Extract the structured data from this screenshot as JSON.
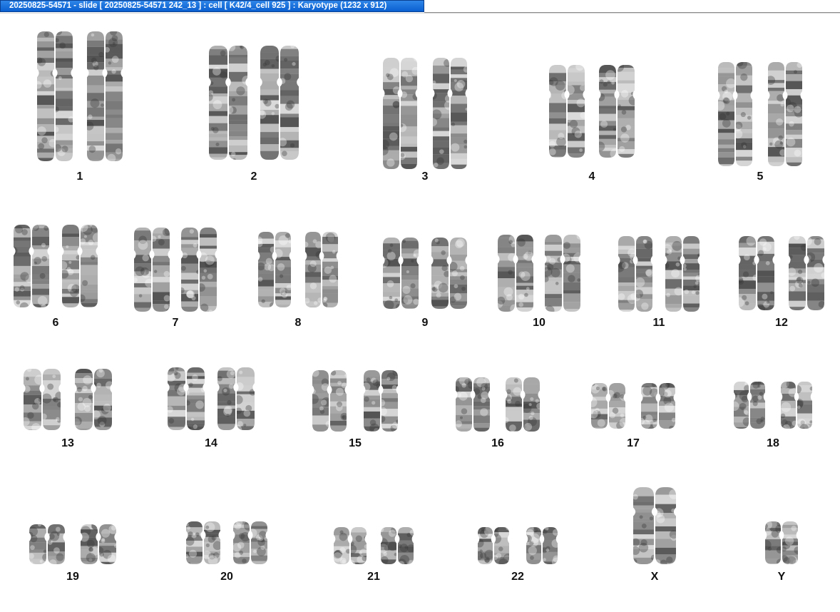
{
  "window": {
    "title": "20250825-54571 - slide [ 20250825-54571 242_13 ] : cell [ K42/4_cell 925 ] : Karyotype  (1232 x 912)"
  },
  "karyotype": {
    "colors": {
      "band_dark": "#1e1e1e",
      "band_light": "#d9d9d9",
      "titlebar": "#0a5fd0"
    },
    "chromosomes": [
      {
        "label": "1"
      },
      {
        "label": "2"
      },
      {
        "label": "3"
      },
      {
        "label": "4"
      },
      {
        "label": "5"
      },
      {
        "label": "6"
      },
      {
        "label": "7"
      },
      {
        "label": "8"
      },
      {
        "label": "9"
      },
      {
        "label": "10"
      },
      {
        "label": "11"
      },
      {
        "label": "12"
      },
      {
        "label": "13"
      },
      {
        "label": "14"
      },
      {
        "label": "15"
      },
      {
        "label": "16"
      },
      {
        "label": "17"
      },
      {
        "label": "18"
      },
      {
        "label": "19"
      },
      {
        "label": "20"
      },
      {
        "label": "21"
      },
      {
        "label": "22"
      },
      {
        "label": "X"
      },
      {
        "label": "Y"
      }
    ]
  }
}
